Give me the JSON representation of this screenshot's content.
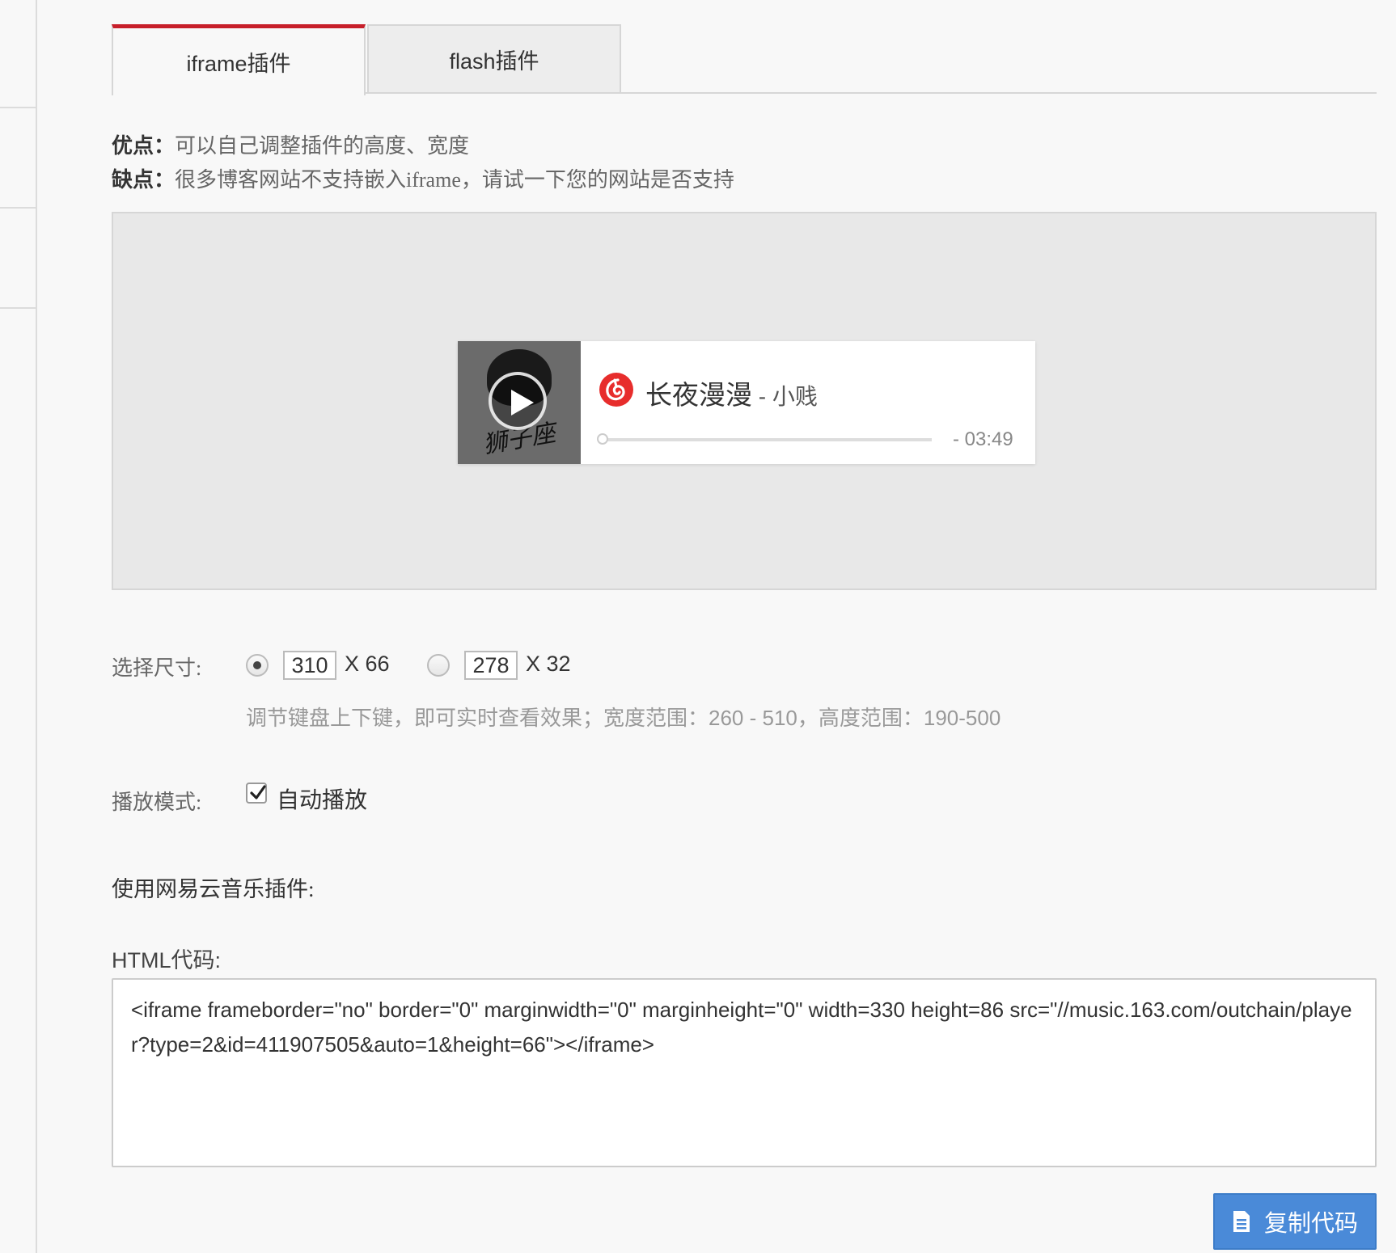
{
  "tabs": [
    {
      "label": "iframe插件",
      "active": true
    },
    {
      "label": "flash插件",
      "active": false
    }
  ],
  "description": {
    "pros_label": "优点：",
    "pros_text": "可以自己调整插件的高度、宽度",
    "cons_label": "缺点：",
    "cons_text": "很多博客网站不支持嵌入iframe，请试一下您的网站是否支持"
  },
  "player": {
    "song_title": "长夜漫漫",
    "artist": " - 小贱",
    "duration": "- 03:49",
    "progress": 0,
    "cover_text": "狮子座"
  },
  "size": {
    "label": "选择尺寸:",
    "options": [
      {
        "width": "310",
        "suffix": "X 66",
        "selected": true
      },
      {
        "width": "278",
        "suffix": "X 32",
        "selected": false
      }
    ],
    "hint": "调节键盘上下键，即可实时查看效果；宽度范围：260 - 510，高度范围：190-500"
  },
  "mode": {
    "label": "播放模式:",
    "autoplay_label": "自动播放",
    "autoplay_checked": true
  },
  "embed": {
    "title": "使用网易云音乐插件:",
    "html_label": "HTML代码:",
    "code": "<iframe frameborder=\"no\" border=\"0\" marginwidth=\"0\" marginheight=\"0\" width=330 height=86 src=\"//music.163.com/outchain/player?type=2&id=411907505&auto=1&height=66\"></iframe>",
    "copy_label": "复制代码"
  },
  "colors": {
    "accent_red": "#c71f2a",
    "button_blue": "#4a8ad8"
  }
}
